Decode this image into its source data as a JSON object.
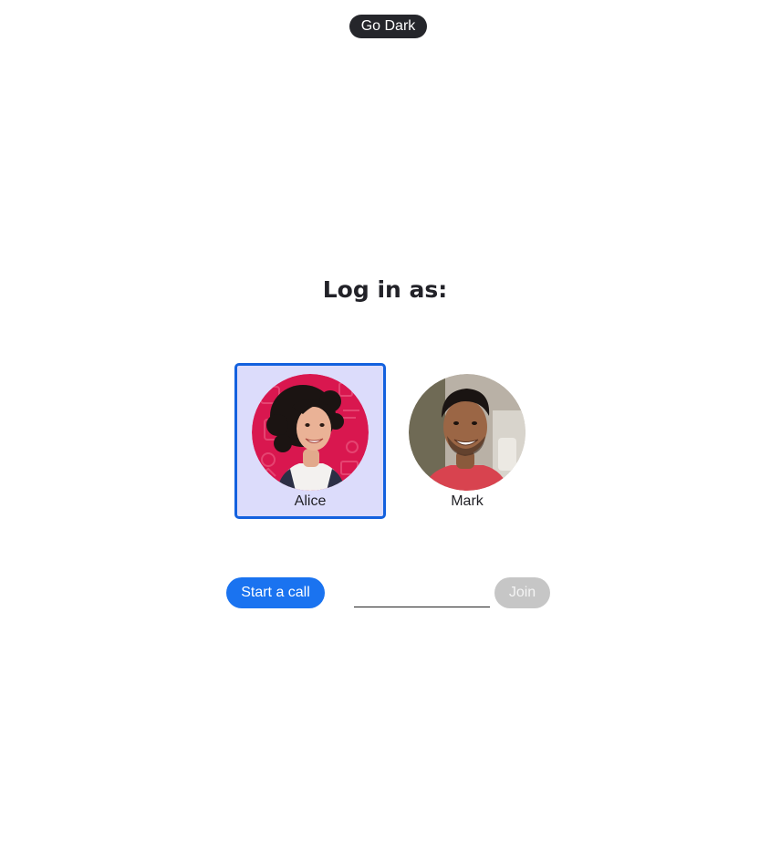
{
  "header": {
    "theme_toggle_label": "Go Dark"
  },
  "login": {
    "heading": "Log in as:",
    "users": [
      {
        "name": "Alice",
        "selected": true,
        "avatar_bg": "#d9174f"
      },
      {
        "name": "Mark",
        "selected": false,
        "avatar_bg": "#b9b1a6"
      }
    ]
  },
  "call": {
    "start_label": "Start a call",
    "join_code_value": "",
    "join_code_placeholder": "",
    "join_label": "Join",
    "join_enabled": false
  },
  "colors": {
    "primary": "#1a73f0",
    "selected_border": "#1361de",
    "selected_bg": "#dcdcfb",
    "dark_button": "#25262b",
    "disabled_button": "#c6c6c6"
  }
}
